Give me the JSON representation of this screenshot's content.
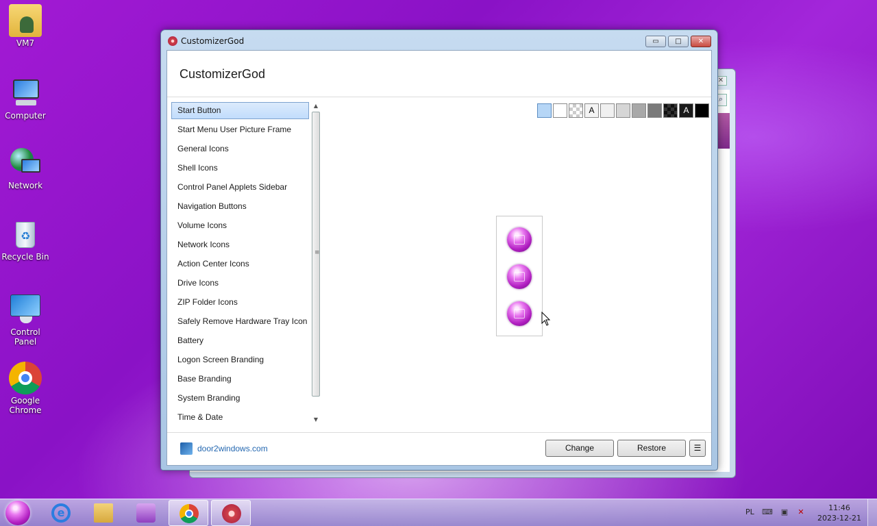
{
  "desktop": {
    "icons": [
      {
        "label": "VM7"
      },
      {
        "label": "Computer"
      },
      {
        "label": "Network"
      },
      {
        "label": "Recycle Bin"
      },
      {
        "label": "Control Panel"
      },
      {
        "label": "Google Chrome"
      }
    ]
  },
  "window": {
    "title": "CustomizerGod",
    "app_heading": "CustomizerGod",
    "controls": {
      "minimize": "▭",
      "maximize": "□",
      "close": "✕"
    }
  },
  "sidebar": {
    "items": [
      {
        "label": "Start Button",
        "selected": true
      },
      {
        "label": "Start Menu User Picture Frame"
      },
      {
        "label": "General Icons"
      },
      {
        "label": "Shell Icons"
      },
      {
        "label": "Control Panel Applets Sidebar"
      },
      {
        "label": "Navigation Buttons"
      },
      {
        "label": "Volume Icons"
      },
      {
        "label": "Network Icons"
      },
      {
        "label": "Action Center Icons"
      },
      {
        "label": "Drive Icons"
      },
      {
        "label": "ZIP Folder Icons"
      },
      {
        "label": "Safely Remove Hardware Tray Icon"
      },
      {
        "label": "Battery"
      },
      {
        "label": "Logon Screen Branding"
      },
      {
        "label": "Base Branding"
      },
      {
        "label": "System Branding"
      },
      {
        "label": "Time & Date"
      }
    ],
    "scroll_up": "▲",
    "scroll_down": "▼",
    "grip": "≡"
  },
  "swatches": [
    {
      "color": "#b6d6f6",
      "text": ""
    },
    {
      "color": "#ffffff",
      "text": ""
    },
    {
      "color": "checker",
      "text": ""
    },
    {
      "color": "#f4f4f4",
      "text": "A"
    },
    {
      "color": "#f0f0f0",
      "text": ""
    },
    {
      "color": "#d6d6d6",
      "text": ""
    },
    {
      "color": "#a8a8a8",
      "text": ""
    },
    {
      "color": "#7a7a7a",
      "text": ""
    },
    {
      "color": "dark-checker",
      "text": ""
    },
    {
      "color": "#1a1a1a",
      "text": "A"
    },
    {
      "color": "#000000",
      "text": ""
    }
  ],
  "preview": {
    "states": [
      "normal",
      "hover",
      "pressed"
    ]
  },
  "footer": {
    "link": "door2windows.com",
    "change_label": "Change",
    "restore_label": "Restore",
    "menu_label": "☰"
  },
  "taskbar": {
    "language": "PL",
    "time": "11:46",
    "date": "2023-12-21",
    "pinned": [
      "internet-explorer",
      "windows-explorer",
      "media-center",
      "google-chrome",
      "customizergod"
    ]
  },
  "colors": {
    "desktop": "#9a18cf",
    "accent_link": "#2367b0",
    "selection": "#c1dcfc"
  }
}
